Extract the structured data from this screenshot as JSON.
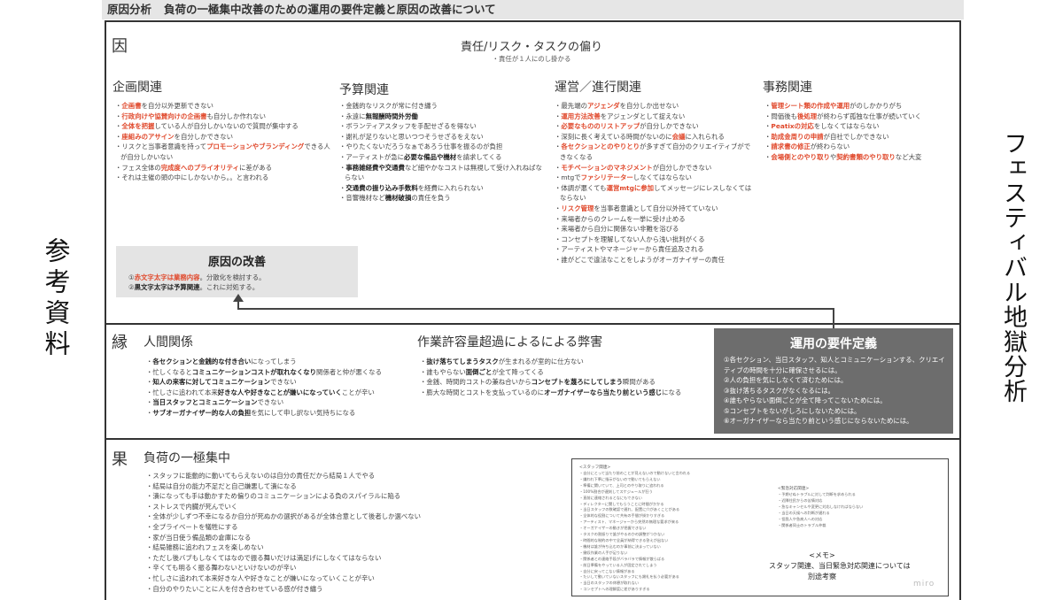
{
  "title": {
    "label": "原因分析",
    "text": "負荷の一極集中改善のための運用の要件定義と原因の改善について"
  },
  "side_left": "参考資料",
  "side_right": "フェスティバル地獄分析",
  "cause": {
    "label": "因",
    "heading": "責任/リスク・タスクの偏り",
    "subheading": "・責任が１人にのし掛かる",
    "columns": [
      {
        "title": "企画関連",
        "items": [
          [
            {
              "t": "企画書",
              "s": "r"
            },
            {
              "t": "を自分以外更新できない"
            }
          ],
          [
            {
              "t": "行政向けや協賛向けの企画書",
              "s": "r"
            },
            {
              "t": "も自分しか作れない"
            }
          ],
          [
            {
              "t": "全体を把握",
              "s": "r"
            },
            {
              "t": "している人が自分しかいないので質問が集中する"
            }
          ],
          [
            {
              "t": "座組みのアサイン",
              "s": "r"
            },
            {
              "t": "を自分しかできない"
            }
          ],
          [
            {
              "t": "リスクと当事者意識を持って"
            },
            {
              "t": "プロモーションやブランディング",
              "s": "r"
            },
            {
              "t": "できる人が自分しかいない"
            }
          ],
          [
            {
              "t": "フェス全体の"
            },
            {
              "t": "完成度へのプライオリティ",
              "s": "r"
            },
            {
              "t": "に差がある"
            }
          ],
          [
            {
              "t": "それは主催の頭の中にしかないから。。と言われる"
            }
          ]
        ]
      },
      {
        "title": "予算関連",
        "items": [
          [
            {
              "t": "金銭的なリスクが常に付き纏う"
            }
          ],
          [
            {
              "t": "永遠に"
            },
            {
              "t": "無報酬時間外労働",
              "s": "b"
            }
          ],
          [
            {
              "t": "ボランティアスタッフを手配せざるを得ない"
            }
          ],
          [
            {
              "t": "謝礼が足りないと思いつつそうせざるをえない"
            }
          ],
          [
            {
              "t": "やりたくないだろうなぁであろう仕事を振るのが負担"
            }
          ],
          [
            {
              "t": "アーティストが急に"
            },
            {
              "t": "必要な備品や機材",
              "s": "b"
            },
            {
              "t": "を請求してくる"
            }
          ],
          [
            {
              "t": "事務雑経費や交通費",
              "s": "b"
            },
            {
              "t": "など細やかなコストは無視して受け入れねばならない"
            }
          ],
          [
            {
              "t": "交通費の振り込み手数料",
              "s": "b"
            },
            {
              "t": "を経費に入れられない"
            }
          ],
          [
            {
              "t": "音響機材など"
            },
            {
              "t": "機材破損",
              "s": "b"
            },
            {
              "t": "の責任を負う"
            }
          ]
        ]
      },
      {
        "title": "運営／進行関連",
        "items": [
          [
            {
              "t": "最先端の"
            },
            {
              "t": "アジェンダ",
              "s": "r"
            },
            {
              "t": "を自分しか出せない"
            }
          ],
          [
            {
              "t": "運用方法改善",
              "s": "r"
            },
            {
              "t": "をアジェンダとして捉えない"
            }
          ],
          [
            {
              "t": "必要なもののリストアップ",
              "s": "r"
            },
            {
              "t": "が自分しかできない"
            }
          ],
          [
            {
              "t": "深刻に長く考えている時間がないのに"
            },
            {
              "t": "会議",
              "s": "r"
            },
            {
              "t": "に入れられる"
            }
          ],
          [
            {
              "t": "各セクションとのやりとり",
              "s": "r"
            },
            {
              "t": "が多すぎて自分のクリエイティブができなくなる"
            }
          ],
          [
            {
              "t": "モチベーションのマネジメント",
              "s": "r"
            },
            {
              "t": "が自分しかできない"
            }
          ],
          [
            {
              "t": "mtgで"
            },
            {
              "t": "ファシリテーター",
              "s": "r"
            },
            {
              "t": "しなくてはならない"
            }
          ],
          [
            {
              "t": "体調が悪くても"
            },
            {
              "t": "運営mtgに参加",
              "s": "r"
            },
            {
              "t": "してメッセージにレスしなくてはならない"
            }
          ],
          [
            {
              "t": "リスク管理",
              "s": "r"
            },
            {
              "t": "を当事者意識として自分以外持てていない"
            }
          ],
          [
            {
              "t": "来場者からのクレームを一挙に受け止める"
            }
          ],
          [
            {
              "t": "来場者から自分に関係ない非難を浴びる"
            }
          ],
          [
            {
              "t": "コンセプトを理解してない人から浅い批判がくる"
            }
          ],
          [
            {
              "t": "アーティストやマネージャーから責任追及される"
            }
          ],
          [
            {
              "t": "誰がどこで違法なことをしようがオーガナイザーの責任"
            }
          ]
        ]
      },
      {
        "title": "事務関連",
        "items": [
          [
            {
              "t": "管理シート類の作成や運用",
              "s": "r"
            },
            {
              "t": "がのしかかりがち"
            }
          ],
          [
            {
              "t": "問価後も"
            },
            {
              "t": "後処理",
              "s": "r"
            },
            {
              "t": "が終わらず孤独な仕事が続いていく"
            }
          ],
          [
            {
              "t": "Peatixの対応",
              "s": "r"
            },
            {
              "t": "をしなくてはならない"
            }
          ],
          [
            {
              "t": "助成金周りの申請",
              "s": "r"
            },
            {
              "t": "が自社でしかできない"
            }
          ],
          [
            {
              "t": "請求書の修正",
              "s": "r"
            },
            {
              "t": "が終わらない"
            }
          ],
          [
            {
              "t": "会場側とのやり取り",
              "s": "r"
            },
            {
              "t": "や"
            },
            {
              "t": "契約書類のやり取り",
              "s": "r"
            },
            {
              "t": "など大変"
            }
          ]
        ]
      }
    ],
    "improvement": {
      "title": "原因の改善",
      "line1": [
        {
          "t": "①"
        },
        {
          "t": "赤文字太字は業務内容",
          "s": "r"
        },
        {
          "t": "。分散化を検討する。"
        }
      ],
      "line2": [
        {
          "t": "②"
        },
        {
          "t": "黒文字太字は予算関連",
          "s": "b"
        },
        {
          "t": "。これに対処する。"
        }
      ]
    }
  },
  "en": {
    "label": "縁",
    "columns": [
      {
        "title": "人間関係",
        "items": [
          [
            {
              "t": "各セクションと金銭的な付き合い",
              "s": "b"
            },
            {
              "t": "になってしまう"
            }
          ],
          [
            {
              "t": "忙しくなると"
            },
            {
              "t": "コミュニケーションコストが取れなくなり",
              "s": "b"
            },
            {
              "t": "関係者と仲が悪くなる"
            }
          ],
          [
            {
              "t": "知人の来客に対してコミュニケーション",
              "s": "b"
            },
            {
              "t": "できない"
            }
          ],
          [
            {
              "t": "忙しさに追われて本来"
            },
            {
              "t": "好きな人や好きなことが嫌いになっていく",
              "s": "b"
            },
            {
              "t": "ことが辛い"
            }
          ],
          [
            {
              "t": "当日スタッフとコミュニケーション",
              "s": "b"
            },
            {
              "t": "できない"
            }
          ],
          [
            {
              "t": "サブオーガナイザー的な人の負担",
              "s": "b"
            },
            {
              "t": "を気にして申し訳ない気持ちになる"
            }
          ]
        ]
      },
      {
        "title": "作業許容量超過によるによる弊害",
        "items": [
          [
            {
              "t": "抜け落ちてしまうタスク",
              "s": "b"
            },
            {
              "t": "が生まれるが室的に仕方ない"
            }
          ],
          [
            {
              "t": "誰もやらない"
            },
            {
              "t": "面倒ごと",
              "s": "b"
            },
            {
              "t": "が全て降ってくる"
            }
          ],
          [
            {
              "t": "金銭、時間的コストの兼ね合いから"
            },
            {
              "t": "コンセプトを蔑ろにしてしまう",
              "s": "b"
            },
            {
              "t": "瞬間がある"
            }
          ],
          [
            {
              "t": "膨大な時間とコストを支払っているのに"
            },
            {
              "t": "オーガナイザーなら当たり前という感じ",
              "s": "b"
            },
            {
              "t": "になる"
            }
          ]
        ]
      }
    ],
    "requirements": {
      "title": "運用の要件定義",
      "items": [
        "①各セクション、当日スタッフ、知人とコミュニケーションする、クリエイティブの時間を十分に確保させるには。",
        "②人の負担を気にしなくて済むためには。",
        "③抜け落ちるタスクがなくなるには。",
        "④誰もやらない面倒ごとが全て降ってこないためには。",
        "⑤コンセプトをないがしろにしないためには。",
        "⑥オーガナイザーなら当たり前という感じにならないためには。"
      ]
    }
  },
  "effect": {
    "label": "果",
    "title": "負荷の一極集中",
    "items": [
      "スタッフに能動的に動いてもらえないのは自分の責任だから結局１人でやる",
      "結局は自分の能力不足だと自己嫌悪して潰になる",
      "潰になっても手は動かすため偏りのコミュニケーションによる負のスパイラルに陥る",
      "ストレスで内臓が死んでいく",
      "全体が少しずつ不幸になるか自分が死ぬかの選択があるが全体合意として後者しか選べない",
      "全プライベートを犠牲にする",
      "家が当日使う備品類の倉庫になる",
      "結局雑務に追われフェスを楽しめない",
      "ただし後バブもしなくてはなので振る舞いだけは満足げにしなくてはならない",
      "辛くても明るく振る舞わないといけないのが辛い",
      "忙しさに追われて本来好きな人や好きなことが嫌いになっていくことが辛い",
      "自分のやりたいことに人を付き合わせている感が付き纏う"
    ],
    "memo": {
      "left_heading": "<スタッフ関連>",
      "left_items": [
        "自分にとって当たり前のことが見えないので動けないと言われる",
        "嫌われ下準に指示がないので動いてもらえない",
        "準備に関いていて、上司とのやり取りに追われる",
        "100%割合が遅刻してスケジュールが狂う",
        "直前に連絡されるとなにもできない",
        "ディレクターに関してもらうことに時間がかかる",
        "当日スタッフの数確認で遅れ、配置に穴があくことがある",
        "全体的な役割について共有の手間が掛かりすぎる",
        "アーティスト、マネージャーから突然の無理な要求が来る",
        "オーガナイザーの動きが把握できない",
        "タスクの割振りで誰がやるのかの調整がつかない",
        "時間的な制約の中で全員が納得できる答えが出ない",
        "機材は誰が持ち込むのか事前に決まっていない",
        "撤収作業の人手が足りない",
        "関係者との連絡手段がバラバラで情報が散らばる",
        "前日準備をやっている人が固定されてしまう",
        "自分に戻ってこない情報がある",
        "たいして動いていないスタッフにも謝礼を払う必要がある",
        "当日のスタッフの休憩が取れない",
        "コンセプトへの理解度に差がありすぎる"
      ],
      "right_heading": "<緊急対応関連>",
      "right_items": [
        "予期せぬトラブルに対して判断を求められる",
        "近隣住民からの苦情対応",
        "急なキャンセルや変更に対応しなければならない",
        "当日の天候への判断が遅れる",
        "怪我人や急病人への対応",
        "関係者同士のトラブル仲裁"
      ],
      "note_title": "<メモ>",
      "note_line1": "スタッフ関連、当日緊急対応関連については",
      "note_line2": "別途考察",
      "brand": "miro"
    }
  }
}
